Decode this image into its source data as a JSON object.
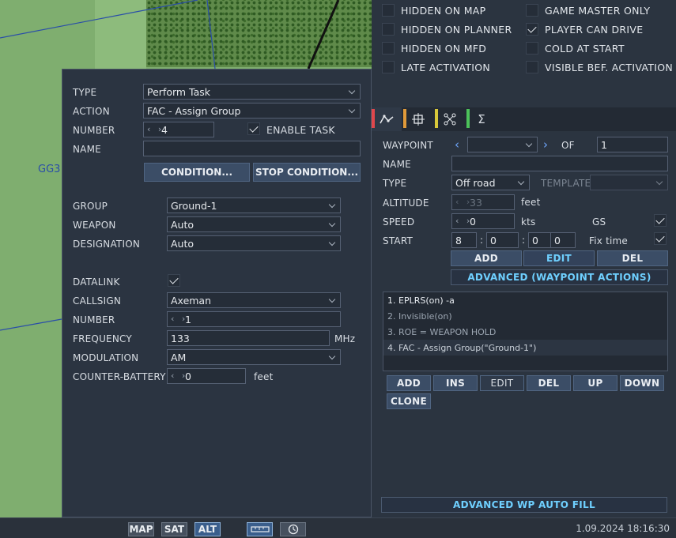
{
  "map": {
    "label": "GG3"
  },
  "task": {
    "type_label": "TYPE",
    "type_value": "Perform Task",
    "action_label": "ACTION",
    "action_value": "FAC - Assign Group",
    "number_label": "NUMBER",
    "number_value": "4",
    "enable_task_label": "ENABLE TASK",
    "enable_task_checked": true,
    "name_label": "NAME",
    "name_value": "",
    "condition_button": "CONDITION...",
    "stop_condition_button": "STOP CONDITION...",
    "group_label": "GROUP",
    "group_value": "Ground-1",
    "weapon_label": "WEAPON",
    "weapon_value": "Auto",
    "designation_label": "DESIGNATION",
    "designation_value": "Auto",
    "datalink_label": "DATALINK",
    "datalink_checked": true,
    "callsign_label": "CALLSIGN",
    "callsign_value": "Axeman",
    "callsign_number_label": "NUMBER",
    "callsign_number_value": "1",
    "frequency_label": "FREQUENCY",
    "frequency_value": "133",
    "frequency_unit": "MHz",
    "modulation_label": "MODULATION",
    "modulation_value": "AM",
    "counter_battery_label": "COUNTER-BATTERY",
    "counter_battery_value": "0",
    "counter_battery_unit": "feet"
  },
  "flags": {
    "hidden_on_map": "HIDDEN ON MAP",
    "hidden_on_planner": "HIDDEN ON PLANNER",
    "hidden_on_mfd": "HIDDEN ON MFD",
    "late_activation": "LATE ACTIVATION",
    "game_master_only": "GAME MASTER ONLY",
    "player_can_drive": "PLAYER CAN DRIVE",
    "cold_at_start": "COLD AT START",
    "visible_bef_activation": "VISIBLE BEF. ACTIVATION"
  },
  "tabs": [
    {
      "icon": "route-icon",
      "stripe": "#e0474c"
    },
    {
      "icon": "target-icon",
      "stripe": "#e09a3a"
    },
    {
      "icon": "triggers-icon",
      "stripe": "#d8c83a"
    },
    {
      "icon": "summary-icon",
      "stripe": "#4cc25a"
    }
  ],
  "waypoint": {
    "waypoint_label": "WAYPOINT",
    "waypoint_value": "",
    "of_label": "OF",
    "of_value": "1",
    "name_label": "NAME",
    "name_value": "",
    "type_label": "TYPE",
    "type_value": "Off road",
    "template_label": "TEMPLATE",
    "template_value": "",
    "altitude_label": "ALTITUDE",
    "altitude_value": "33",
    "altitude_unit": "feet",
    "speed_label": "SPEED",
    "speed_value": "0",
    "speed_unit": "kts",
    "gs_label": "GS",
    "gs_checked": true,
    "start_label": "START",
    "start_h": "8",
    "start_m": "0",
    "start_s": "0",
    "start_f": "0",
    "fix_time_label": "Fix time",
    "fix_time_checked": true,
    "add_button": "ADD",
    "edit_button": "EDIT",
    "del_button": "DEL",
    "advanced_button": "ADVANCED (WAYPOINT ACTIONS)"
  },
  "actions": {
    "items": [
      "1. EPLRS(on)  -a",
      "2. Invisible(on)",
      "3. ROE = WEAPON HOLD",
      "4. FAC - Assign Group(\"Ground-1\")"
    ],
    "add": "ADD",
    "ins": "INS",
    "edit": "EDIT",
    "del": "DEL",
    "up": "UP",
    "down": "DOWN",
    "clone": "CLONE",
    "auto_fill": "ADVANCED WP AUTO FILL"
  },
  "statusbar": {
    "map": "MAP",
    "sat": "SAT",
    "alt": "ALT",
    "datetime": "1.09.2024 18:16:30"
  }
}
